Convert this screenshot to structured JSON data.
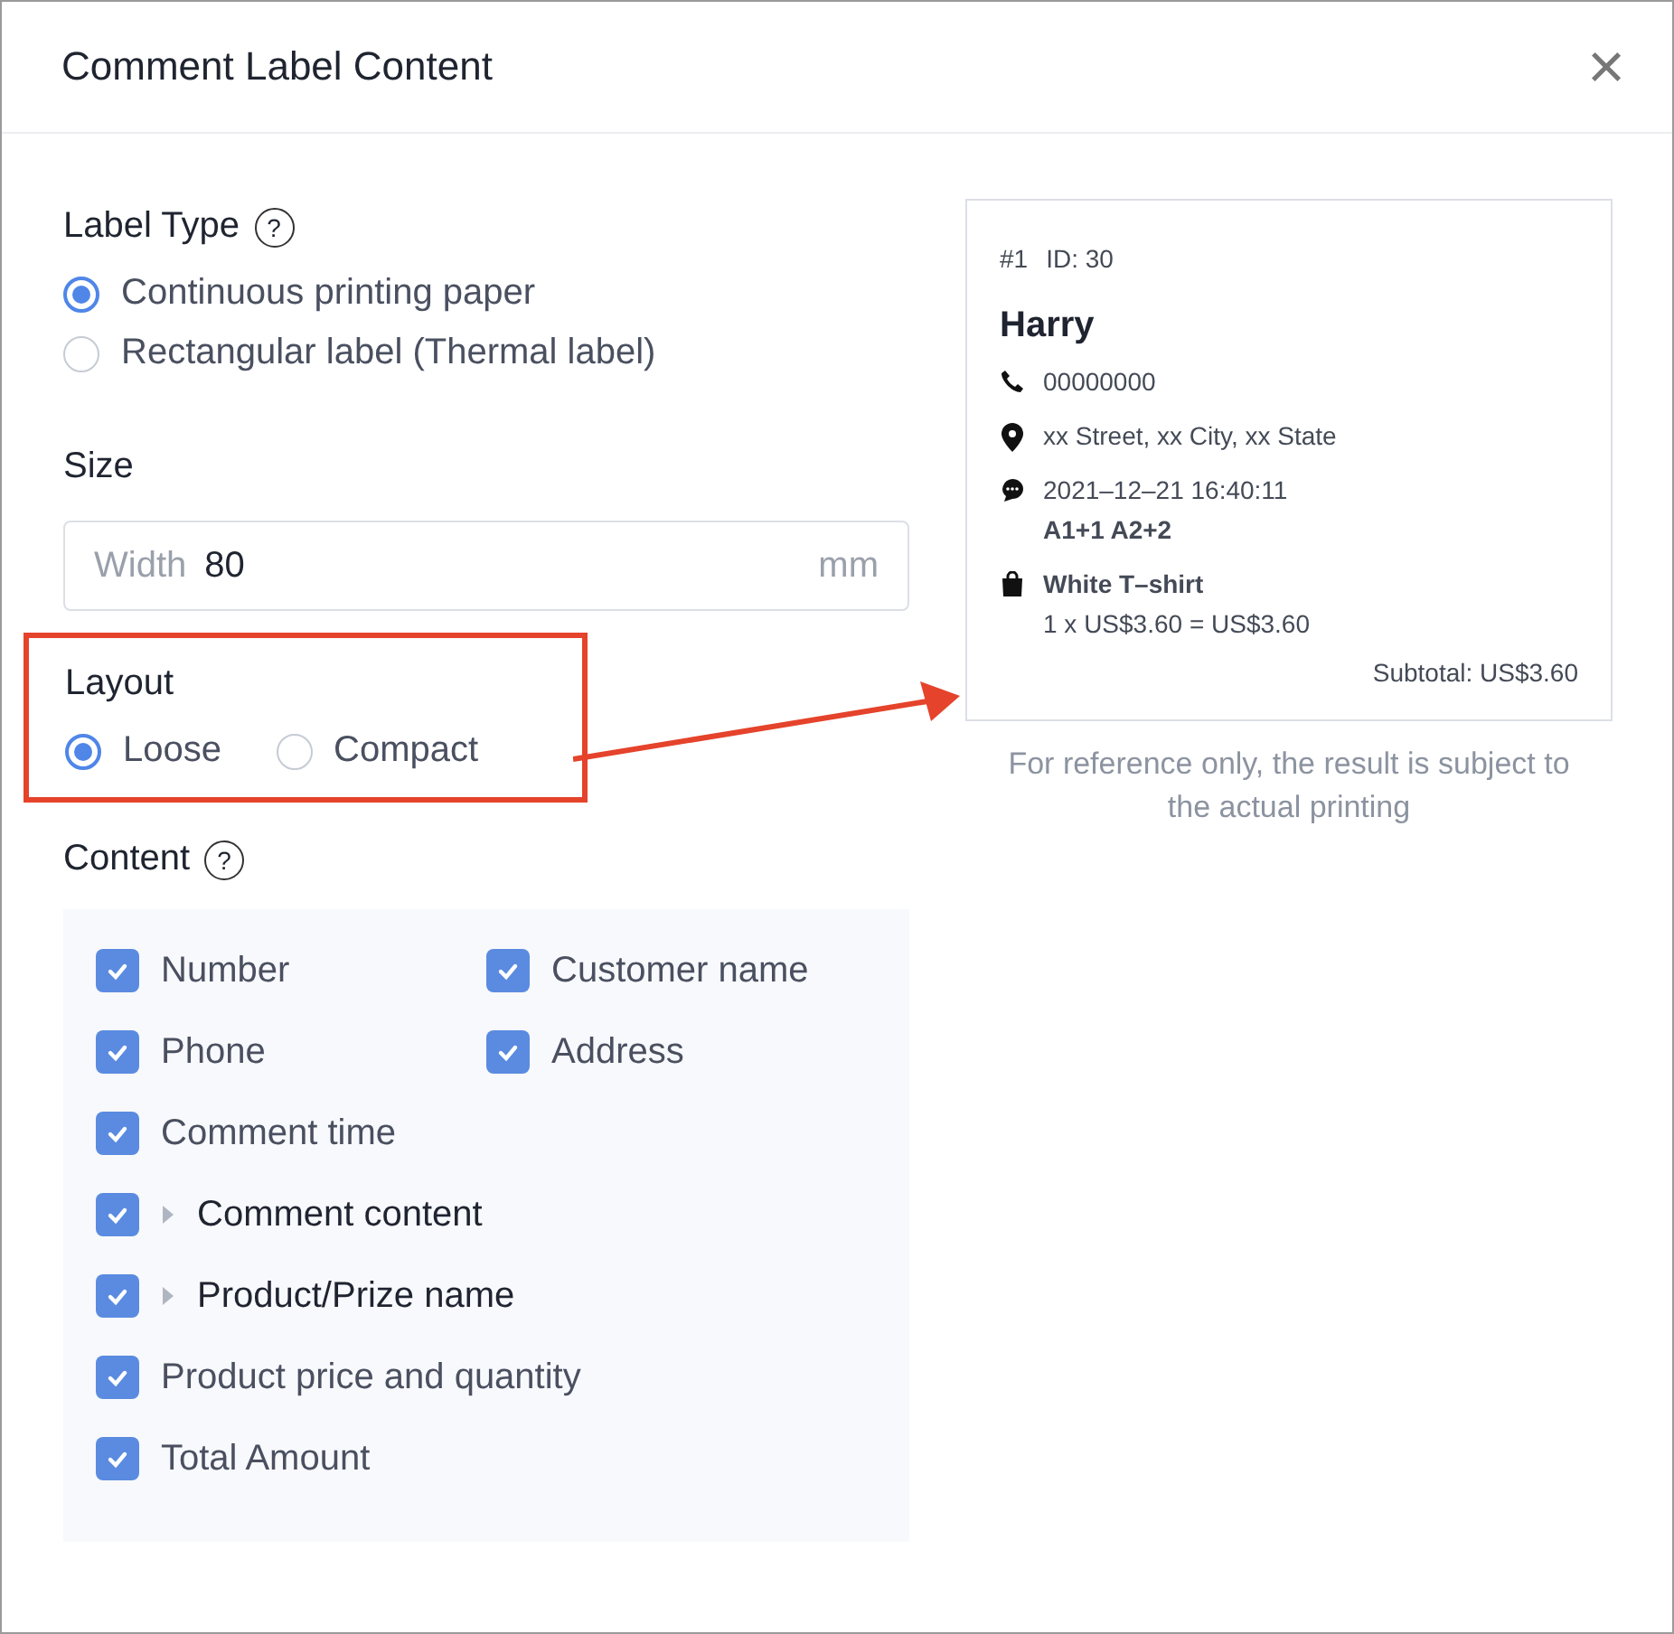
{
  "dialog": {
    "title": "Comment Label Content",
    "close": "×"
  },
  "label_type": {
    "title": "Label Type",
    "help": "?",
    "options": [
      {
        "label": "Continuous printing paper",
        "selected": true
      },
      {
        "label": "Rectangular label (Thermal label)",
        "selected": false
      }
    ]
  },
  "size": {
    "title": "Size",
    "placeholder": "Width",
    "value": "80",
    "unit": "mm"
  },
  "layout": {
    "title": "Layout",
    "highlighted": true,
    "options": [
      {
        "label": "Loose",
        "selected": true
      },
      {
        "label": "Compact",
        "selected": false
      }
    ]
  },
  "content": {
    "title": "Content",
    "help": "?",
    "rows": [
      [
        {
          "label": "Number",
          "checked": true,
          "kind": "plain"
        },
        {
          "label": "Customer name",
          "checked": true,
          "kind": "plain"
        }
      ],
      [
        {
          "label": "Phone",
          "checked": true,
          "kind": "plain"
        },
        {
          "label": "Address",
          "checked": true,
          "kind": "plain"
        }
      ],
      [
        {
          "label": "Comment time",
          "checked": true,
          "kind": "plain"
        }
      ],
      [
        {
          "label": "Comment content",
          "checked": true,
          "kind": "expandable",
          "expanded": false
        }
      ],
      [
        {
          "label": "Product/Prize name",
          "checked": true,
          "kind": "expandable",
          "expanded": false
        }
      ],
      [
        {
          "label": "Product price and quantity",
          "checked": true,
          "kind": "plain"
        }
      ],
      [
        {
          "label": "Total Amount",
          "checked": true,
          "kind": "plain"
        }
      ]
    ]
  },
  "preview": {
    "number": "#1",
    "id": "ID: 30",
    "name": "Harry",
    "lines": [
      {
        "kind": "phone",
        "texts": [
          "00000000"
        ]
      },
      {
        "kind": "location",
        "texts": [
          "xx Street, xx City, xx State"
        ]
      },
      {
        "kind": "comment",
        "texts": [
          "2021–12–21 16:40:11",
          "**A1+1 A2+2**"
        ]
      },
      {
        "kind": "product",
        "texts": [
          "**White T–shirt**",
          "1 x US$3.60 = US$3.60"
        ]
      }
    ],
    "subtotal": "Subtotal: US$3.60",
    "note": "For reference only, the result is subject to the actual printing"
  }
}
